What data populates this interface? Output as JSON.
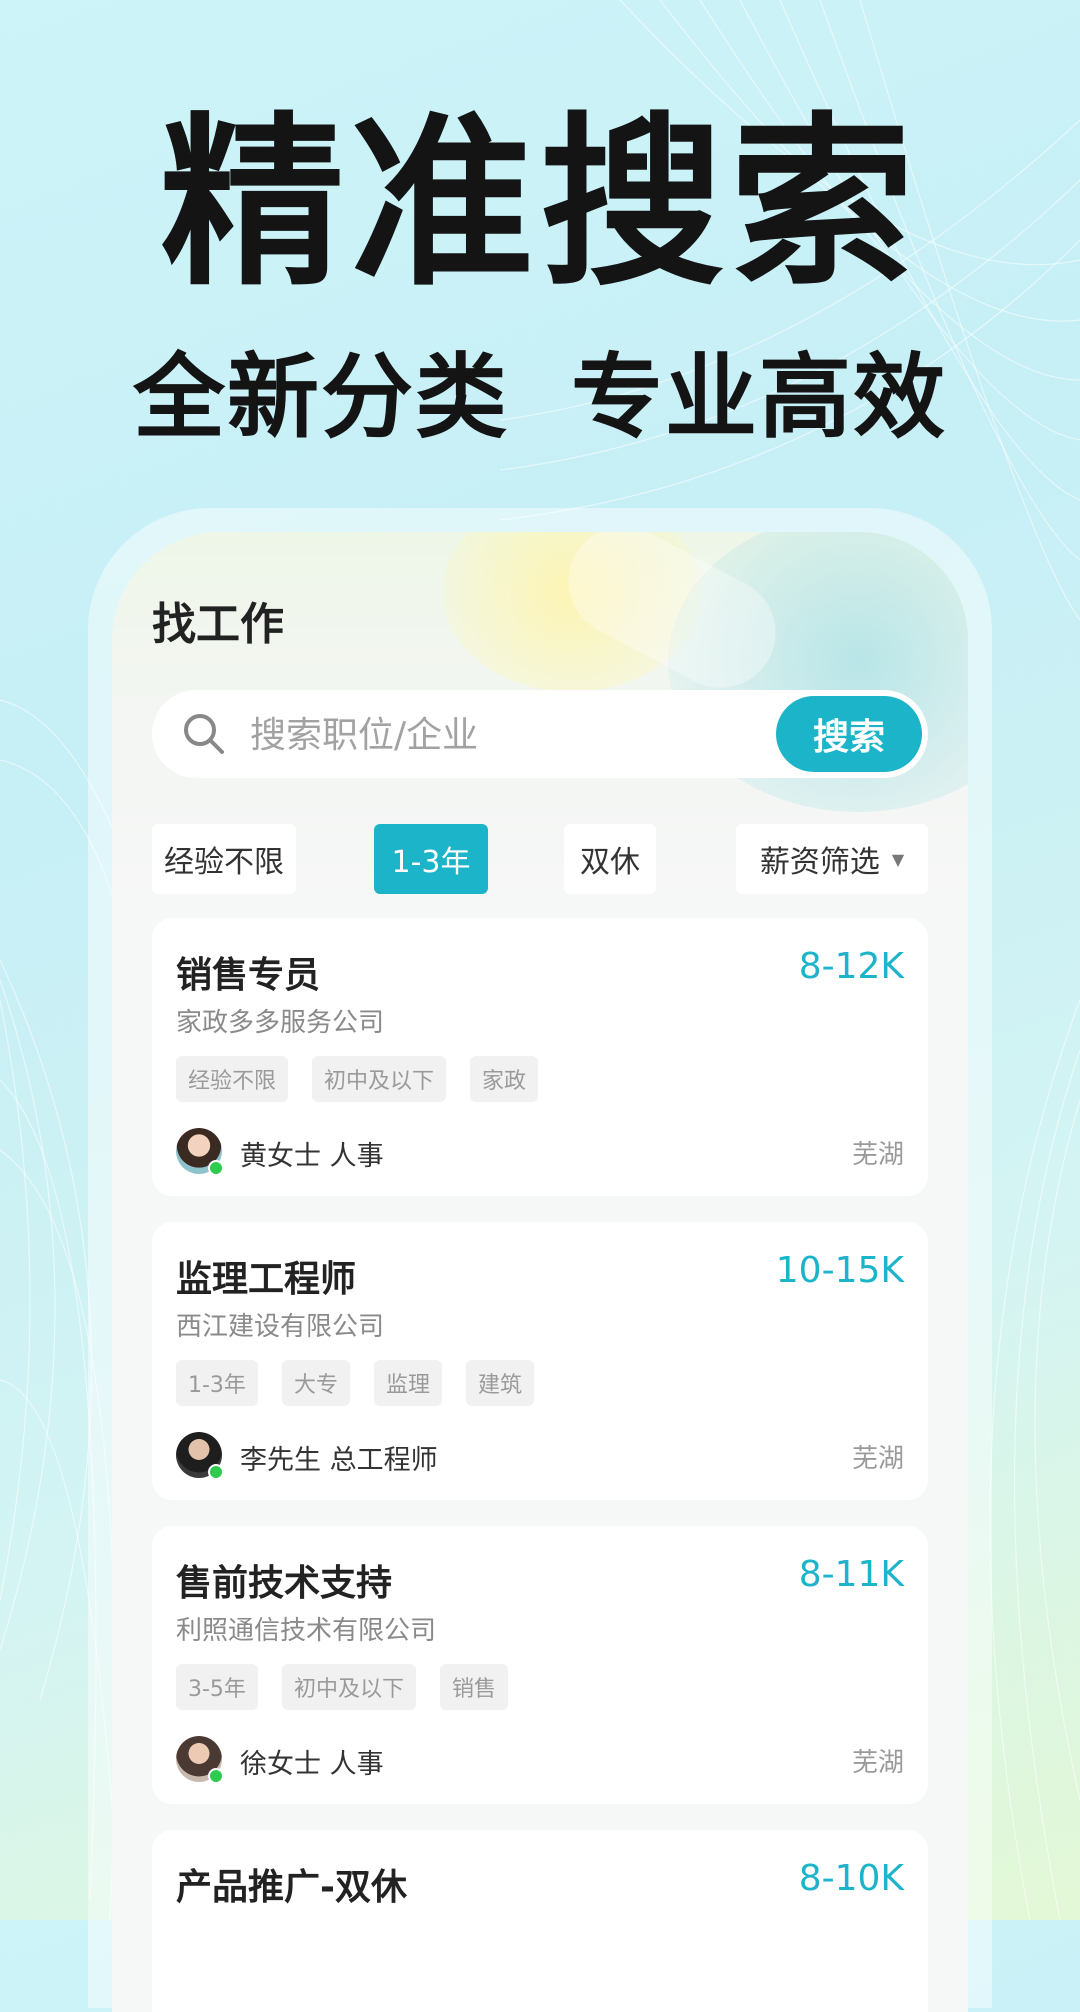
{
  "hero": {
    "title": "精准搜索",
    "subtitle_left": "全新分类",
    "subtitle_right": "专业高效"
  },
  "screen": {
    "title": "找工作",
    "search": {
      "placeholder": "搜索职位/企业",
      "button_label": "搜索",
      "icon": "search-icon"
    },
    "filters": [
      {
        "label": "经验不限",
        "active": false
      },
      {
        "label": "1-3年",
        "active": true
      },
      {
        "label": "双休",
        "active": false
      },
      {
        "label": "薪资筛选",
        "active": false,
        "icon": "caret-down-icon"
      }
    ],
    "jobs": [
      {
        "title": "销售专员",
        "salary": "8-12K",
        "company": "家政多多服务公司",
        "tags": [
          "经验不限",
          "初中及以下",
          "家政"
        ],
        "recruiter": "黄女士 人事",
        "city": "芜湖"
      },
      {
        "title": "监理工程师",
        "salary": "10-15K",
        "company": "西江建设有限公司",
        "tags": [
          "1-3年",
          "大专",
          "监理",
          "建筑"
        ],
        "recruiter": "李先生 总工程师",
        "city": "芜湖"
      },
      {
        "title": "售前技术支持",
        "salary": "8-11K",
        "company": "利照通信技术有限公司",
        "tags": [
          "3-5年",
          "初中及以下",
          "销售"
        ],
        "recruiter": "徐女士 人事",
        "city": "芜湖"
      },
      {
        "title": "产品推广-双休",
        "salary": "8-10K"
      }
    ]
  },
  "colors": {
    "accent": "#1bb4c9",
    "online": "#2ecc4e",
    "text_primary": "#222222",
    "text_secondary": "#8a8a8a"
  }
}
